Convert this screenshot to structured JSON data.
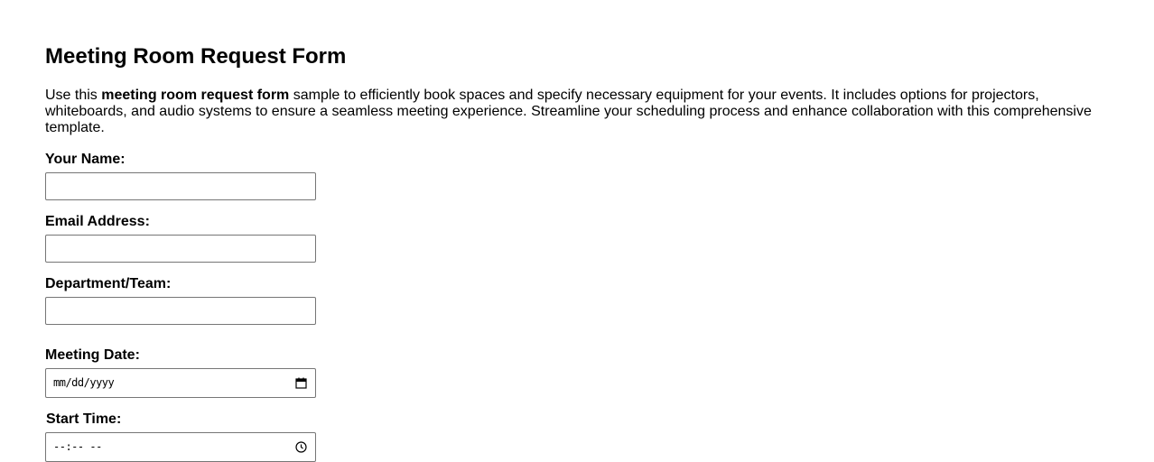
{
  "form": {
    "title": "Meeting Room Request Form",
    "intro": {
      "before": "Use this ",
      "bold": "meeting room request form",
      "after": " sample to efficiently book spaces and specify necessary equipment for your events. It includes options for projectors, whiteboards, and audio systems to ensure a seamless meeting experience. Streamline your scheduling process and enhance collaboration with this comprehensive template."
    },
    "fields": {
      "name_label": "Your Name:",
      "email_label": "Email Address:",
      "department_label": "Department/Team:",
      "date_label": "Meeting Date:",
      "date_placeholder": "mm/dd/yyyy",
      "start_label": "Start Time:",
      "start_placeholder": "--:-- --"
    },
    "icons": {
      "date": "calendar-icon",
      "time": "clock-icon"
    }
  }
}
